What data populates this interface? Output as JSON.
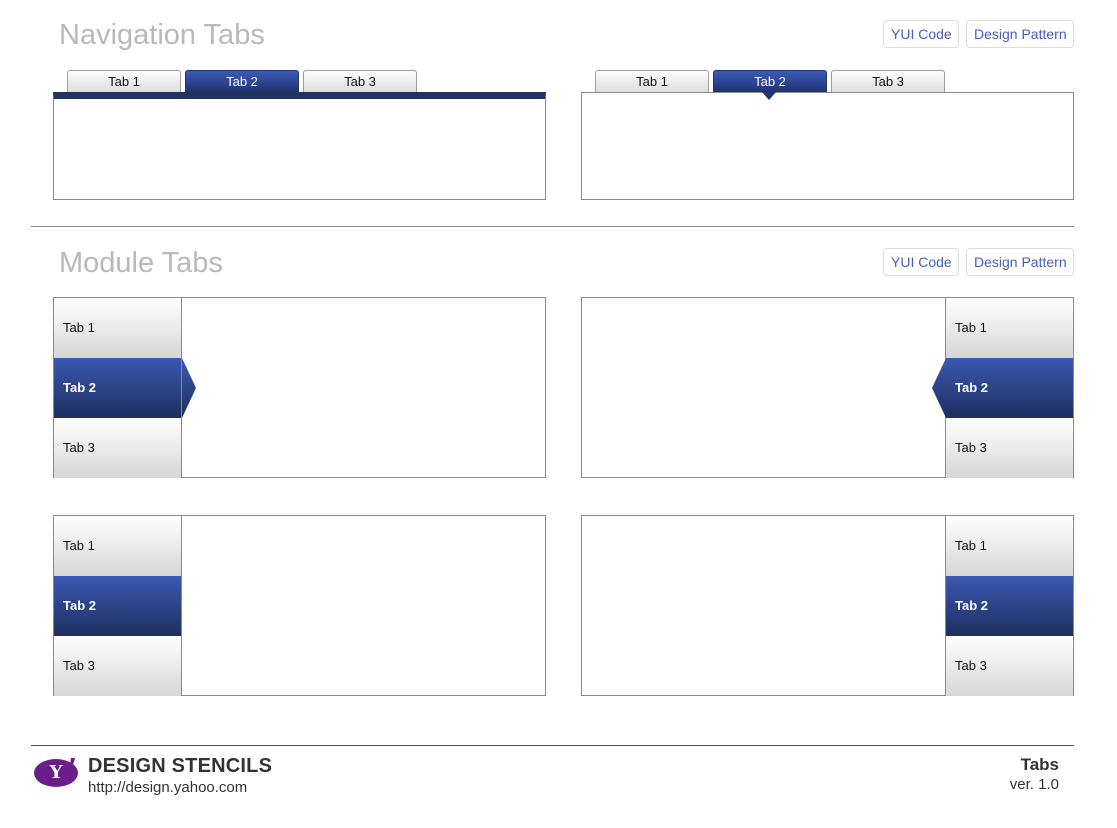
{
  "navigation": {
    "title": "Navigation Tabs",
    "yui_code_label": "YUI Code",
    "design_pattern_label": "Design Pattern",
    "tabs": [
      "Tab 1",
      "Tab 2",
      "Tab 3"
    ],
    "active_tab": "Tab 2"
  },
  "module": {
    "title": "Module Tabs",
    "yui_code_label": "YUI Code",
    "design_pattern_label": "Design Pattern",
    "tabs": [
      "Tab 1",
      "Tab 2",
      "Tab 3"
    ],
    "active_tab": "Tab 2"
  },
  "colors": {
    "accent_dark": "#24335c",
    "accent_mid": "#3b58b2",
    "link": "#4a5cc0",
    "section_title": "#b9b9b9",
    "logo_purple": "#6b1d8a"
  },
  "footer": {
    "logo_icon": "yahoo-logo",
    "logo_letter": "Y",
    "logo_bang": "!",
    "brand": "DESIGN STENCILS",
    "url": "http://design.yahoo.com",
    "doc_title": "Tabs",
    "version": "ver. 1.0"
  }
}
